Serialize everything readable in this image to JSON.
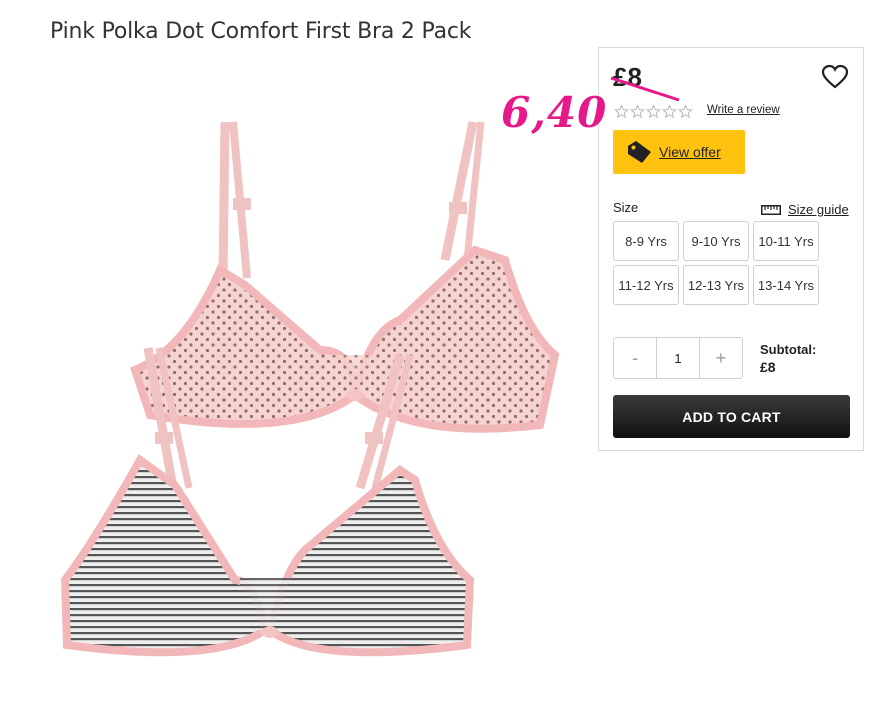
{
  "product": {
    "title": "Pink Polka Dot Comfort First Bra 2 Pack"
  },
  "pricing": {
    "old_price": "£8",
    "sale_price_annotation": "6,40",
    "review_link": "Write a review",
    "rating_stars": 0,
    "offer_button": "View offer"
  },
  "size": {
    "label": "Size",
    "guide_link": "Size guide",
    "options": [
      "8-9 Yrs",
      "9-10 Yrs",
      "10-11 Yrs",
      "11-12 Yrs",
      "12-13 Yrs",
      "13-14 Yrs"
    ]
  },
  "quantity": {
    "minus": "-",
    "value": "1",
    "plus": "+"
  },
  "subtotal": {
    "label": "Subtotal:",
    "value": "£8"
  },
  "cart": {
    "add_label": "ADD TO CART"
  },
  "colors": {
    "accent_yellow": "#ffc20e",
    "annotation_pink": "#e6198a",
    "cart_button": "#1c1c1c"
  },
  "icons": {
    "wishlist": "heart-icon",
    "offer": "price-tag-icon",
    "size_guide": "ruler-icon",
    "rating": "star-icon"
  }
}
